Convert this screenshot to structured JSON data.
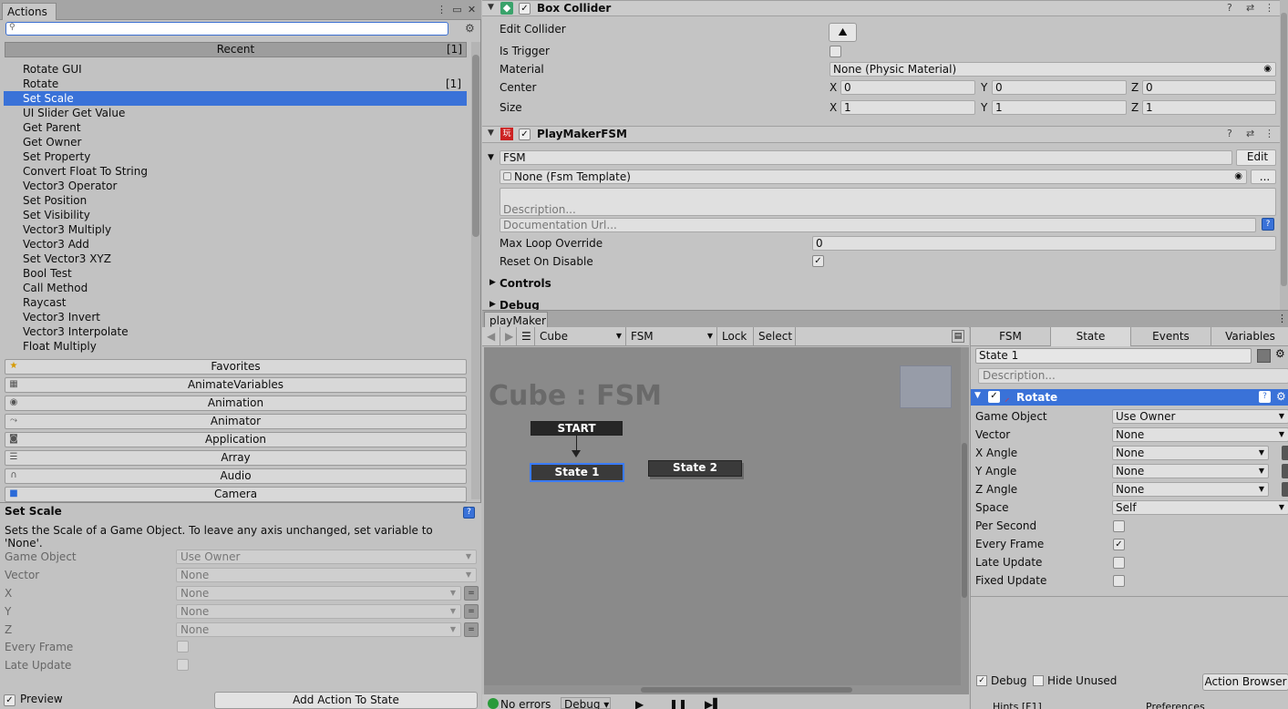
{
  "actions_panel": {
    "tab_label": "Actions",
    "search_value": "",
    "recent": {
      "label": "Recent",
      "count": "[1]"
    },
    "items": [
      {
        "label": "Rotate GUI",
        "count": ""
      },
      {
        "label": "Rotate",
        "count": "[1]"
      },
      {
        "label": "Set Scale",
        "count": "",
        "selected": true
      },
      {
        "label": "UI Slider Get Value",
        "count": ""
      },
      {
        "label": "Get Parent",
        "count": ""
      },
      {
        "label": "Get Owner",
        "count": ""
      },
      {
        "label": "Set Property",
        "count": ""
      },
      {
        "label": "Convert Float To String",
        "count": ""
      },
      {
        "label": "Vector3 Operator",
        "count": ""
      },
      {
        "label": "Set Position",
        "count": ""
      },
      {
        "label": "Set Visibility",
        "count": ""
      },
      {
        "label": "Vector3 Multiply",
        "count": ""
      },
      {
        "label": "Vector3 Add",
        "count": ""
      },
      {
        "label": "Set Vector3 XYZ",
        "count": ""
      },
      {
        "label": "Bool Test",
        "count": ""
      },
      {
        "label": "Call Method",
        "count": ""
      },
      {
        "label": "Raycast",
        "count": ""
      },
      {
        "label": "Vector3 Invert",
        "count": ""
      },
      {
        "label": "Vector3 Interpolate",
        "count": ""
      },
      {
        "label": "Float Multiply",
        "count": ""
      }
    ],
    "categories": [
      {
        "label": "Favorites",
        "icon": "star-icon"
      },
      {
        "label": "AnimateVariables",
        "icon": "grid-icon"
      },
      {
        "label": "Animation",
        "icon": "play-circle-icon"
      },
      {
        "label": "Animator",
        "icon": "animator-icon"
      },
      {
        "label": "Application",
        "icon": "gamepad-icon"
      },
      {
        "label": "Array",
        "icon": "list-icon"
      },
      {
        "label": "Audio",
        "icon": "headphones-icon"
      },
      {
        "label": "Camera",
        "icon": "camera-icon"
      }
    ],
    "detail": {
      "title": "Set Scale",
      "description": "Sets the Scale of a Game Object. To leave any axis unchanged, set variable to 'None'.",
      "fields": [
        {
          "label": "Game Object",
          "value": "Use Owner"
        },
        {
          "label": "Vector",
          "value": "None"
        },
        {
          "label": "X",
          "value": "None"
        },
        {
          "label": "Y",
          "value": "None"
        },
        {
          "label": "Z",
          "value": "None"
        }
      ],
      "every_frame": "Every Frame",
      "late_update": "Late Update",
      "preview_label": "Preview",
      "add_action_label": "Add Action To State"
    }
  },
  "inspector": {
    "box_collider": {
      "title": "Box Collider",
      "edit_collider": "Edit Collider",
      "is_trigger": "Is Trigger",
      "material_label": "Material",
      "material_value": "None (Physic Material)",
      "center_label": "Center",
      "center": {
        "x": "0",
        "y": "0",
        "z": "0"
      },
      "size_label": "Size",
      "size": {
        "x": "1",
        "y": "1",
        "z": "1"
      }
    },
    "playmaker_fsm": {
      "title": "PlayMakerFSM",
      "fsm_name": "FSM",
      "edit_label": "Edit",
      "template_value": "None (Fsm Template)",
      "template_button": "...",
      "description_placeholder": "Description...",
      "doc_url_placeholder": "Documentation Url...",
      "max_loop_label": "Max Loop Override",
      "max_loop_value": "0",
      "reset_label": "Reset On Disable",
      "controls_label": "Controls",
      "debug_label": "Debug"
    }
  },
  "playmaker": {
    "tab_label": "playMaker",
    "toolbar": {
      "object": "Cube",
      "fsm": "FSM",
      "lock": "Lock",
      "select": "Select"
    },
    "graph_title": "Cube : FSM",
    "start_label": "START",
    "state1_label": "State 1",
    "state2_label": "State 2",
    "status": {
      "errors": "No errors",
      "debug": "Debug"
    },
    "right_tabs": [
      "FSM",
      "State",
      "Events",
      "Variables"
    ],
    "state_name": "State 1",
    "state_description_placeholder": "Description...",
    "action_title": "Rotate",
    "action_fields": [
      {
        "label": "Game Object",
        "value": "Use Owner"
      },
      {
        "label": "Vector",
        "value": "None"
      },
      {
        "label": "X Angle",
        "value": "None"
      },
      {
        "label": "Y Angle",
        "value": "None"
      },
      {
        "label": "Z Angle",
        "value": "None"
      },
      {
        "label": "Space",
        "value": "Self"
      }
    ],
    "action_checks": [
      {
        "label": "Per Second",
        "checked": false
      },
      {
        "label": "Every Frame",
        "checked": true
      },
      {
        "label": "Late Update",
        "checked": false
      },
      {
        "label": "Fixed Update",
        "checked": false
      }
    ],
    "bottom": {
      "debug": "Debug",
      "hide_unused": "Hide Unused",
      "action_browser": "Action Browser",
      "hints": "Hints [F1]",
      "preferences": "Preferences"
    }
  }
}
